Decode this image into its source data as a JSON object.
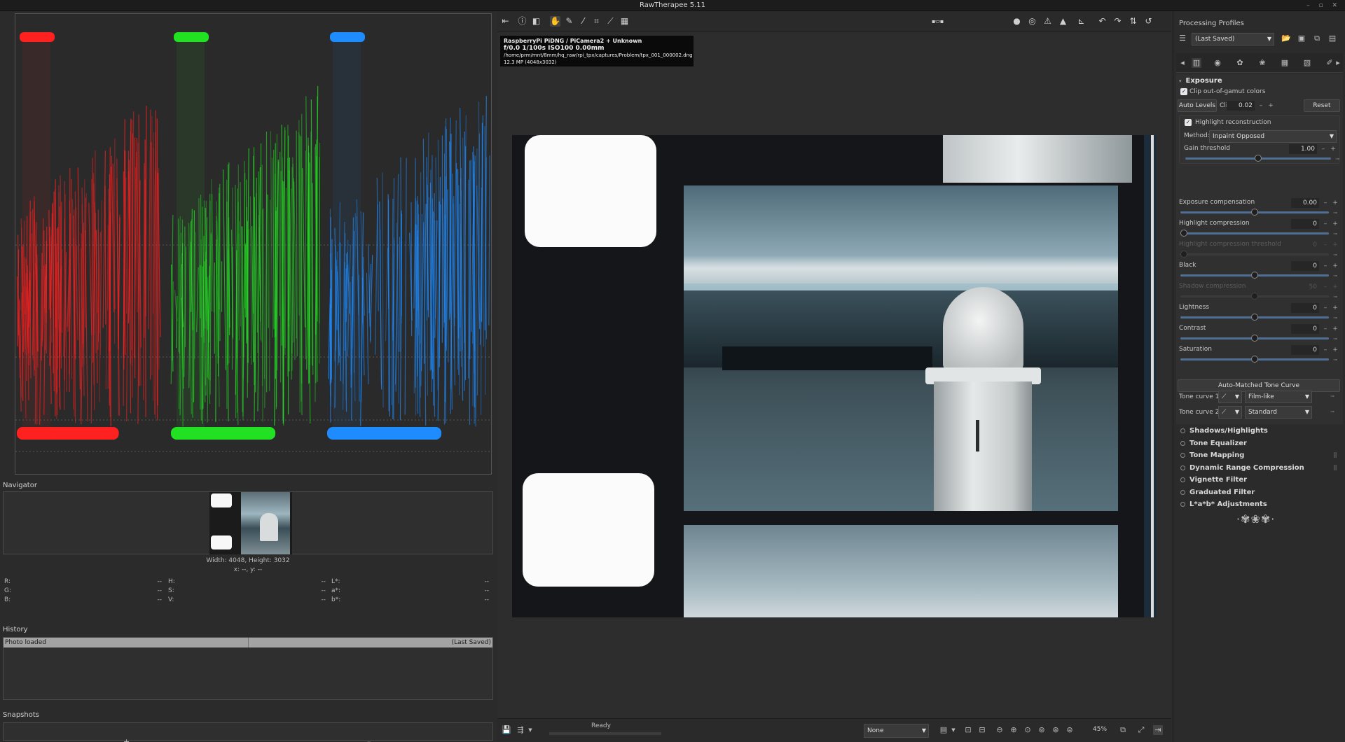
{
  "window": {
    "title": "RawTherapee 5.11",
    "controls": "– ▫ ✕"
  },
  "left_panel": {
    "navigator": {
      "title": "Navigator",
      "size_text": "Width: 4048, Height: 3032",
      "coords_text": "x: --, y: --"
    },
    "pixel_info": {
      "col1": [
        {
          "label": "R:",
          "value": "--"
        },
        {
          "label": "G:",
          "value": "--"
        },
        {
          "label": "B:",
          "value": "--"
        }
      ],
      "col2": [
        {
          "label": "H:",
          "value": "--"
        },
        {
          "label": "S:",
          "value": "--"
        },
        {
          "label": "V:",
          "value": "--"
        }
      ],
      "col3": [
        {
          "label": "L*:",
          "value": "--"
        },
        {
          "label": "a*:",
          "value": "--"
        },
        {
          "label": "b*:",
          "value": "--"
        }
      ]
    },
    "history": {
      "title": "History",
      "rows": [
        {
          "action": "Photo loaded",
          "value": "(Last Saved)"
        }
      ]
    },
    "snapshots": {
      "title": "Snapshots",
      "add": "+",
      "remove": "–"
    }
  },
  "histogram": {
    "colors": {
      "red": "#ff2020",
      "green": "#22e022",
      "blue": "#1e8cff"
    }
  },
  "image_info": {
    "camera": "RaspberryPi PiDNG / PiCamera2 + Unknown",
    "exposure": "f/0.0  1/100s  ISO100  0.00mm",
    "path": "/home/prm/mnt/8mm/hq_raw/rpi_tpx/captures/Problem/tpx_001_000002.dng",
    "megapixels": "12.3 MP (4048x3032)"
  },
  "statusbar": {
    "status": "Ready",
    "preview_mode": "None",
    "zoom": "45%"
  },
  "right_panel": {
    "processing_profiles": {
      "title": "Processing Profiles",
      "selected": "(Last Saved)"
    },
    "exposure": {
      "title": "Exposure",
      "clip_gamut_label": "Clip out-of-gamut colors",
      "auto_levels_label": "Auto Levels",
      "clip_label": "Clip %",
      "clip_value": "0.02",
      "reset_label": "Reset",
      "highlight_reconstruction_label": "Highlight reconstruction",
      "method_label": "Method:",
      "method_value": "Inpaint Opposed",
      "gain_threshold": {
        "label": "Gain threshold",
        "value": "1.00",
        "level": 0.5
      },
      "sliders": [
        {
          "label": "Exposure compensation",
          "value": "0.00",
          "level": 0.5,
          "disabled": false
        },
        {
          "label": "Highlight compression",
          "value": "0",
          "level": 0.0,
          "disabled": false
        },
        {
          "label": "Highlight compression threshold",
          "value": "0",
          "level": 0.0,
          "disabled": true
        },
        {
          "label": "Black",
          "value": "0",
          "level": 0.5,
          "disabled": false
        },
        {
          "label": "Shadow compression",
          "value": "50",
          "level": 0.5,
          "disabled": true
        },
        {
          "label": "Lightness",
          "value": "0",
          "level": 0.5,
          "disabled": false
        },
        {
          "label": "Contrast",
          "value": "0",
          "level": 0.5,
          "disabled": false
        },
        {
          "label": "Saturation",
          "value": "0",
          "level": 0.5,
          "disabled": false
        }
      ],
      "auto_tone_curve_label": "Auto-Matched Tone Curve",
      "tone_curve_1": {
        "label": "Tone curve 1:",
        "value": "Film-like"
      },
      "tone_curve_2": {
        "label": "Tone curve 2:",
        "value": "Standard"
      }
    },
    "collapsed_sections": [
      {
        "label": "Shadows/Highlights",
        "extra": ""
      },
      {
        "label": "Tone Equalizer",
        "extra": ""
      },
      {
        "label": "Tone Mapping",
        "extra": "||"
      },
      {
        "label": "Dynamic Range Compression",
        "extra": "||"
      },
      {
        "label": "Vignette Filter",
        "extra": ""
      },
      {
        "label": "Graduated Filter",
        "extra": ""
      },
      {
        "label": "L*a*b* Adjustments",
        "extra": ""
      }
    ]
  }
}
